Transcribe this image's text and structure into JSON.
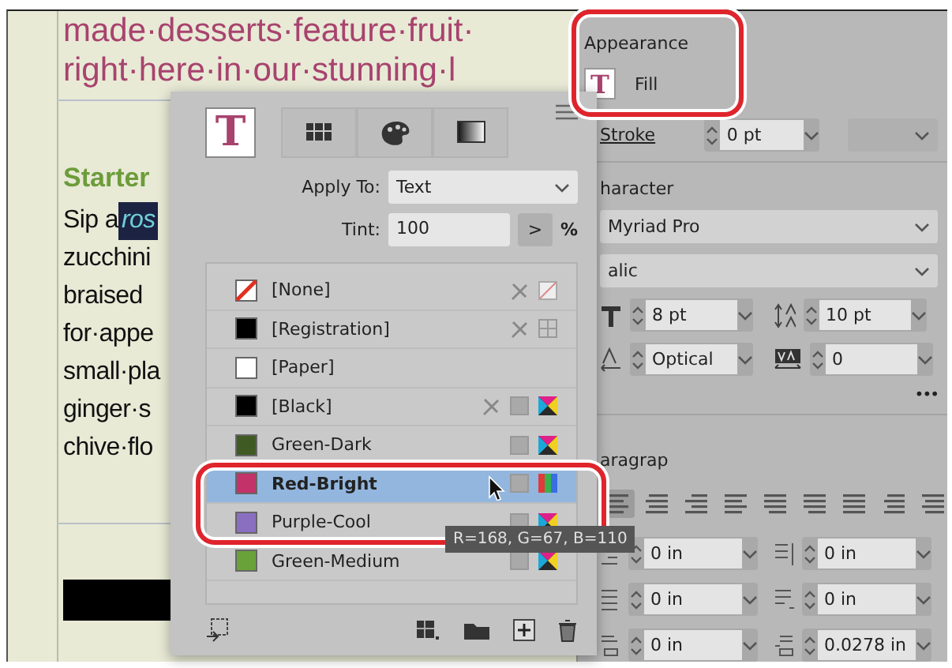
{
  "document": {
    "lines": [
      {
        "kind": "accent",
        "text": "made·desserts·feature·fruit·"
      },
      {
        "kind": "accent",
        "text": "right·here·in·our·stunning·l"
      },
      {
        "kind": "heading",
        "text": "Starter"
      },
      {
        "kind": "body",
        "text": "Sip a",
        "highlight": "ros"
      },
      {
        "kind": "body",
        "text": "zucchini"
      },
      {
        "kind": "body",
        "text": "braised"
      },
      {
        "kind": "body",
        "text": "for·appe"
      },
      {
        "kind": "body",
        "text": "small·pla"
      },
      {
        "kind": "body",
        "text": "ginger·s"
      },
      {
        "kind": "body",
        "text": "chive·flo"
      }
    ]
  },
  "swatches_panel": {
    "tabs": [
      {
        "kind": "text",
        "label": "T",
        "selected": true
      },
      {
        "kind": "grid",
        "selected": false
      },
      {
        "kind": "palette",
        "selected": false
      },
      {
        "kind": "gradient",
        "selected": false
      }
    ],
    "apply_to": {
      "label": "Apply To:",
      "value": "Text"
    },
    "tint": {
      "label": "Tint:",
      "value": "100",
      "step": ">",
      "unit": "%"
    },
    "swatches": [
      {
        "name": "[None]",
        "kind": "none",
        "color": "#ffffff",
        "editable": false,
        "selected": false
      },
      {
        "name": "[Registration]",
        "kind": "registration",
        "color": "#000000",
        "editable": false,
        "selected": false
      },
      {
        "name": "[Paper]",
        "kind": "plain",
        "color": "#ffffff",
        "editable": true,
        "selected": false
      },
      {
        "name": "[Black]",
        "kind": "cmyk",
        "color": "#000000",
        "editable": false,
        "selected": false
      },
      {
        "name": "Green-Dark",
        "kind": "cmyk",
        "color": "#3f5a22",
        "editable": true,
        "selected": false
      },
      {
        "name": "Red-Bright",
        "kind": "rgb",
        "color": "#c3336a",
        "editable": true,
        "selected": true
      },
      {
        "name": "Purple-Cool",
        "kind": "cmyk",
        "color": "#8a6fc0",
        "editable": true,
        "selected": false
      },
      {
        "name": "Green-Medium",
        "kind": "cmyk",
        "color": "#6aa23a",
        "editable": true,
        "selected": false
      }
    ],
    "tooltip": "R=168, G=67, B=110"
  },
  "properties": {
    "appearance": {
      "title": "Appearance",
      "fill_icon": "T",
      "fill": "Fill",
      "stroke": "Stroke",
      "stroke_weight": "0 pt"
    },
    "character": {
      "title": "haracter",
      "font": "Myriad Pro",
      "style": "alic",
      "size": "8 pt",
      "leading": "10 pt",
      "kerning": "Optical",
      "tracking": "0",
      "more": "•••"
    },
    "paragraph": {
      "title": "aragrap",
      "alignments": [
        {
          "selected": true
        },
        {
          "selected": false
        },
        {
          "selected": false
        },
        {
          "selected": false
        },
        {
          "selected": false
        },
        {
          "selected": false
        },
        {
          "selected": false
        },
        {
          "selected": false
        },
        {
          "selected": false
        }
      ],
      "indents": [
        "0 in",
        "0 in",
        "0 in",
        "0 in",
        "0 in",
        "0.0278 in"
      ]
    }
  }
}
